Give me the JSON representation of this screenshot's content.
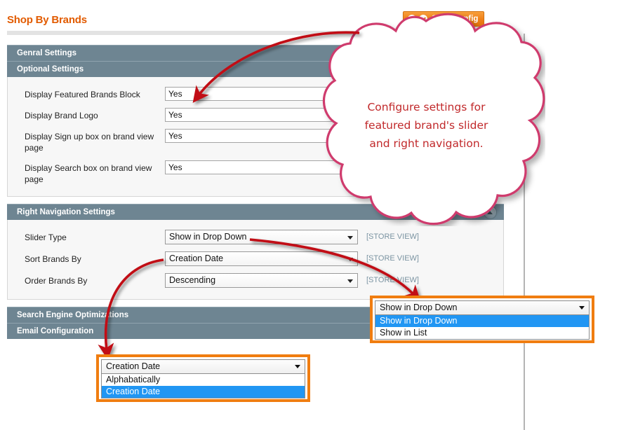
{
  "page": {
    "title": "Shop By Brands"
  },
  "toolbar": {
    "save_label": "Save Config",
    "icons": [
      "check-circle-icon",
      "check-circle-icon"
    ],
    "accent_color": "#ef7e16"
  },
  "sections": {
    "general": {
      "title": "Genral Settings"
    },
    "optional": {
      "title": "Optional Settings",
      "fields": [
        {
          "label": "Display Featured Brands Block",
          "value": "Yes"
        },
        {
          "label": "Display Brand Logo",
          "value": "Yes"
        },
        {
          "label": "Display Sign up box on brand view page",
          "value": "Yes"
        },
        {
          "label": "Display Search box on brand view page",
          "value": "Yes"
        }
      ]
    },
    "right_nav": {
      "title": "Right Navigation Settings",
      "collapse_icon": "collapse-up-icon",
      "fields": [
        {
          "label": "Slider Type",
          "value": "Show in Drop Down",
          "scope": "[STORE VIEW]"
        },
        {
          "label": "Sort Brands By",
          "value": "Creation Date",
          "scope": "[STORE VIEW]"
        },
        {
          "label": "Order Brands By",
          "value": "Descending",
          "scope": "[STORE VIEW]"
        }
      ]
    },
    "seo": {
      "title": "Search Engine Optimizations"
    },
    "email": {
      "title": "Email Configuration"
    }
  },
  "callout": {
    "line1": "Configure settings for",
    "line2": "featured brand's slider",
    "line3": "and right navigation.",
    "text_color": "#c1292b",
    "border_color": "#cf3a6d"
  },
  "popups": {
    "slider_type": {
      "display": "Show in Drop Down",
      "options": [
        {
          "label": "Show in Drop Down",
          "selected": true
        },
        {
          "label": "Show in List",
          "selected": false
        }
      ],
      "highlight_color": "#f07d10"
    },
    "sort_brands_by": {
      "display": "Creation Date",
      "options": [
        {
          "label": "Alphabatically",
          "selected": false
        },
        {
          "label": "Creation Date",
          "selected": true
        }
      ],
      "highlight_color": "#f07d10"
    }
  }
}
